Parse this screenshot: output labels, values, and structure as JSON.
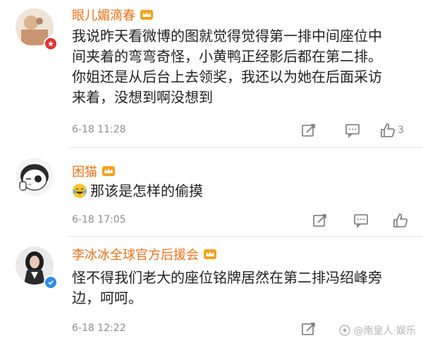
{
  "comments": [
    {
      "username": "眼儿媚滴春",
      "lines": [
        "我说昨天看微博的图就觉得觉得第一排中间座位中",
        "间夹着的弯弯奇怪，小黄鸭正经影后都在第二排。",
        "你姐还是从后台上去领奖，我还以为她在后面采访",
        "来着，没想到啊没想到"
      ],
      "time": "6-18 11:28",
      "likes": "3"
    },
    {
      "username": "困猫",
      "text": "那该是怎样的偷摸",
      "emoji": "laugh-cry",
      "time": "6-18 17:05"
    },
    {
      "username": "李冰冰全球官方后援会",
      "lines": [
        "怪不得我们老大的座位铭牌居然在第二排冯绍峰旁",
        "边，呵呵。"
      ],
      "time": "6-18 12:22"
    }
  ],
  "watermark": "@南皇人·娱乐",
  "colors": {
    "username": "#e8731c",
    "text": "#222222",
    "meta": "#8d8d8d",
    "crown": "#f2a21a"
  }
}
